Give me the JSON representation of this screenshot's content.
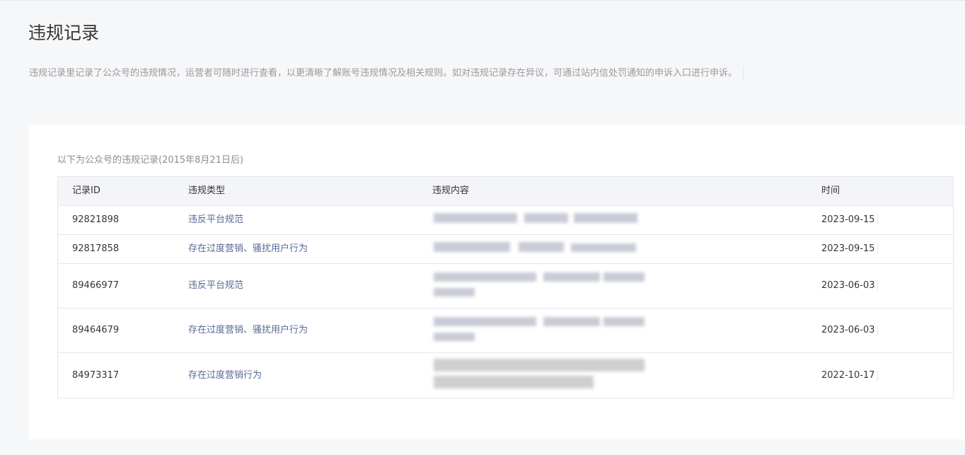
{
  "page": {
    "title": "违规记录",
    "description": "违规记录里记录了公众号的违规情况，运营者可随时进行查看，以更清晰了解账号违规情况及相关规则。如对违规记录存在异议，可通过站内信处罚通知的申诉入口进行申诉。"
  },
  "card": {
    "intro": "以下为公众号的违规记录(2015年8月21日后)",
    "table": {
      "headers": {
        "id": "记录ID",
        "type": "违规类型",
        "content": "违规内容",
        "time": "时间"
      },
      "rows": [
        {
          "id": "92821898",
          "type": "违反平台规范",
          "content": "",
          "time": "2023-09-15"
        },
        {
          "id": "92817858",
          "type": "存在过度营销、骚扰用户行为",
          "content": "",
          "time": "2023-09-15"
        },
        {
          "id": "89466977",
          "type": "违反平台规范",
          "content": "",
          "time": "2023-06-03"
        },
        {
          "id": "89464679",
          "type": "存在过度营销、骚扰用户行为",
          "content": "",
          "time": "2023-06-03"
        },
        {
          "id": "84973317",
          "type": "存在过度营销行为",
          "content": "",
          "time": "2022-10-17"
        }
      ]
    }
  },
  "colors": {
    "background": "#f6f7f9",
    "card": "#ffffff",
    "type_link": "#576b95",
    "muted_text": "#9a9a9a",
    "border": "#e4e6eb",
    "header_bg": "#f4f5f9"
  }
}
